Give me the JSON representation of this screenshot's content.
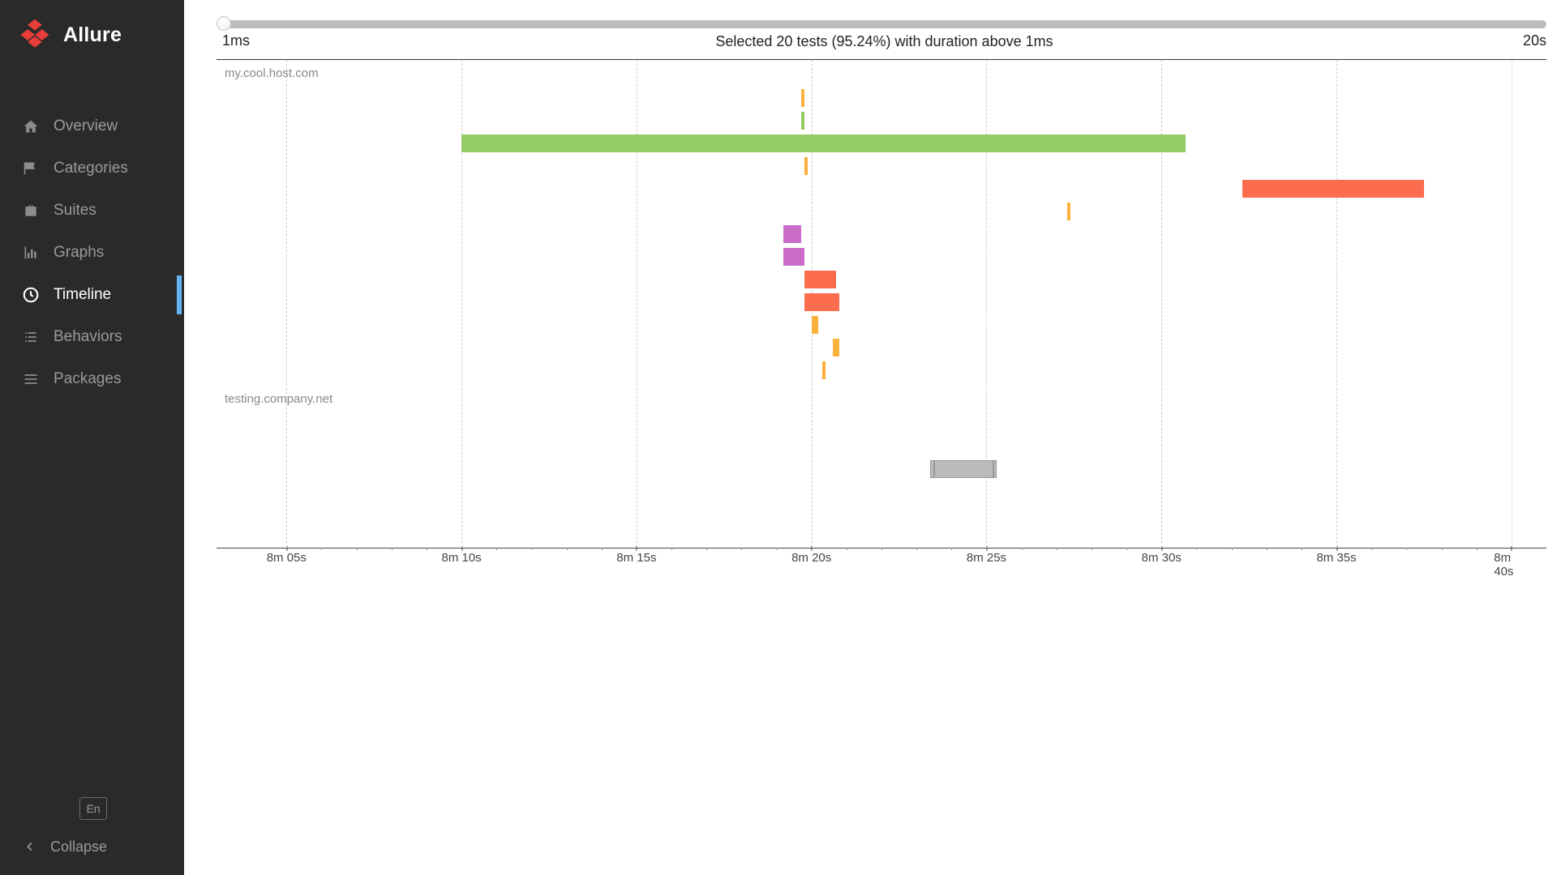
{
  "brand": {
    "title": "Allure"
  },
  "sidebar": {
    "items": [
      {
        "icon": "home-icon",
        "label": "Overview",
        "active": false
      },
      {
        "icon": "flag-icon",
        "label": "Categories",
        "active": false
      },
      {
        "icon": "briefcase-icon",
        "label": "Suites",
        "active": false
      },
      {
        "icon": "bar-chart-icon",
        "label": "Graphs",
        "active": false
      },
      {
        "icon": "clock-icon",
        "label": "Timeline",
        "active": true
      },
      {
        "icon": "list-icon",
        "label": "Behaviors",
        "active": false
      },
      {
        "icon": "list-lines-icon",
        "label": "Packages",
        "active": false
      }
    ]
  },
  "footer": {
    "lang": "En",
    "collapse": "Collapse"
  },
  "slider": {
    "min_label": "1ms",
    "max_label": "20s",
    "summary": "Selected 20 tests (95.24%) with duration above 1ms"
  },
  "timeline": {
    "hosts": [
      {
        "name": "my.cool.host.com"
      },
      {
        "name": "testing.company.net"
      }
    ],
    "xticks": [
      "8m 05s",
      "8m 10s",
      "8m 15s",
      "8m 20s",
      "8m 25s",
      "8m 30s",
      "8m 35s",
      "8m 40s"
    ],
    "xrange_sec": [
      483,
      521
    ]
  },
  "colors": {
    "passed": "#95cb65",
    "failed": "#fc6c4f",
    "broken": "#fcb13c",
    "unknown": "#cb6ccb",
    "skipped": "#bbbbbb",
    "skipped_border": "#999999"
  },
  "chart_data": {
    "type": "bar",
    "orientation": "horizontal-gantt",
    "title": "Timeline",
    "xunit": "seconds",
    "x_range": [
      483,
      521
    ],
    "hosts": [
      {
        "name": "my.cool.host.com",
        "threads": [
          [
            {
              "start": 499.7,
              "end": 499.8,
              "status": "broken"
            }
          ],
          [
            {
              "start": 499.7,
              "end": 499.8,
              "status": "passed"
            }
          ],
          [
            {
              "start": 490.0,
              "end": 510.7,
              "status": "passed"
            }
          ],
          [
            {
              "start": 499.8,
              "end": 499.9,
              "status": "broken"
            }
          ],
          [
            {
              "start": 512.3,
              "end": 517.5,
              "status": "failed"
            }
          ],
          [
            {
              "start": 507.3,
              "end": 507.4,
              "status": "broken"
            }
          ],
          [
            {
              "start": 499.2,
              "end": 499.7,
              "status": "unknown"
            }
          ],
          [
            {
              "start": 499.2,
              "end": 499.8,
              "status": "unknown"
            }
          ],
          [
            {
              "start": 499.8,
              "end": 500.7,
              "status": "failed"
            }
          ],
          [
            {
              "start": 499.8,
              "end": 500.8,
              "status": "failed"
            }
          ],
          [
            {
              "start": 500.0,
              "end": 500.2,
              "status": "broken"
            }
          ],
          [
            {
              "start": 500.6,
              "end": 500.8,
              "status": "broken"
            }
          ],
          [
            {
              "start": 500.3,
              "end": 500.4,
              "status": "broken"
            }
          ]
        ]
      },
      {
        "name": "testing.company.net",
        "threads": [
          [],
          [],
          [
            {
              "start": 503.4,
              "end": 503.5,
              "status": "skipped"
            },
            {
              "start": 503.5,
              "end": 505.2,
              "status": "skipped"
            },
            {
              "start": 505.2,
              "end": 505.3,
              "status": "skipped"
            }
          ]
        ]
      }
    ]
  }
}
